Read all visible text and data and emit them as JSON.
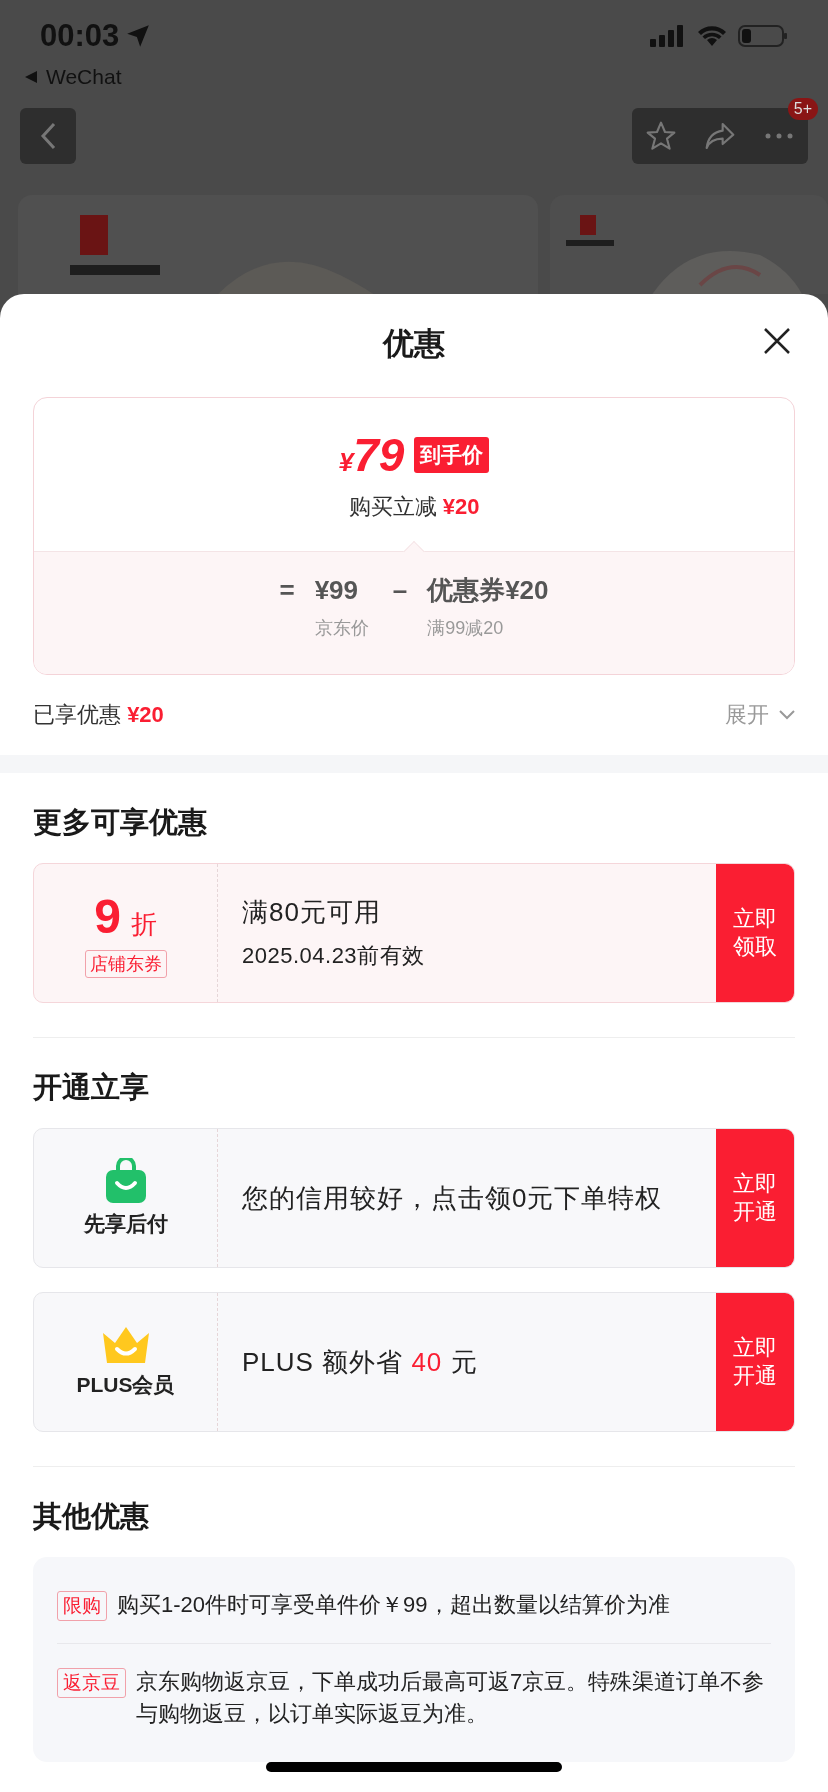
{
  "status_bar": {
    "time": "00:03",
    "back_app": "WeChat"
  },
  "nav": {
    "badge": "5+"
  },
  "sheet": {
    "title": "优惠",
    "price_card": {
      "currency": "¥",
      "price": "79",
      "price_tag": "到手价",
      "instant_label": "购买立减",
      "instant_amount": "¥20",
      "formula": [
        {
          "operator": "=",
          "value": "¥99",
          "caption": "京东价"
        },
        {
          "operator": "–",
          "value": "优惠券¥20",
          "caption": "满99减20"
        }
      ]
    },
    "enjoyed": {
      "label": "已享优惠",
      "amount": "¥20",
      "expand": "展开",
      "expanded": false
    },
    "more": {
      "heading": "更多可享优惠",
      "coupons": [
        {
          "discount": "9",
          "unit": "折",
          "tag": "店铺东券",
          "condition": "满80元可用",
          "validity": "2025.04.23前有效",
          "action": "立即领取"
        }
      ]
    },
    "open": {
      "heading": "开通立享",
      "offers": [
        {
          "kind": "pay_later",
          "name": "先享后付",
          "description": [
            {
              "text": "您的信用较好，点击领0元下单特权",
              "highlight": false
            }
          ],
          "action": "立即开通"
        },
        {
          "kind": "plus",
          "name": "PLUS会员",
          "description": [
            {
              "text": "PLUS 额外省 ",
              "highlight": false
            },
            {
              "text": "40",
              "highlight": true
            },
            {
              "text": " 元",
              "highlight": false
            }
          ],
          "action": "立即开通"
        }
      ]
    },
    "other": {
      "heading": "其他优惠",
      "items": [
        {
          "tag": "限购",
          "text": "购买1-20件时可享受单件价￥99，超出数量以结算价为准"
        },
        {
          "tag": "返京豆",
          "text": "京东购物返京豆，下单成功后最高可返7京豆。特殊渠道订单不参与购物返豆，以订单实际返豆为准。"
        }
      ]
    }
  }
}
